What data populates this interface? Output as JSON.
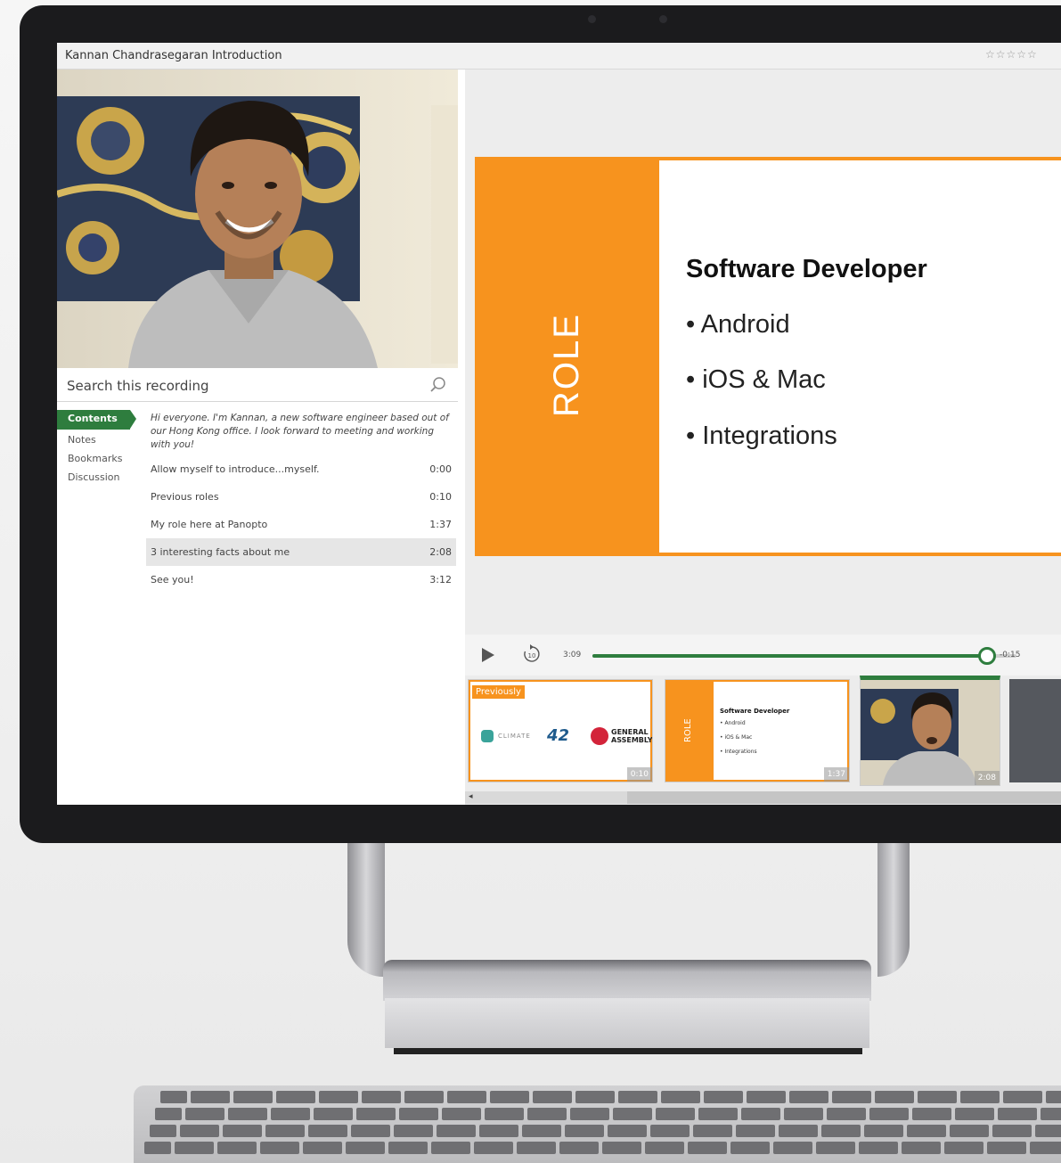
{
  "window": {
    "title": "Kannan Chandrasegaran Introduction",
    "rating": "☆☆☆☆☆"
  },
  "search": {
    "placeholder": "Search this recording"
  },
  "nav": {
    "items": [
      {
        "label": "Contents",
        "active": true
      },
      {
        "label": "Notes",
        "active": false
      },
      {
        "label": "Bookmarks",
        "active": false
      },
      {
        "label": "Discussion",
        "active": false
      }
    ]
  },
  "transcript": {
    "caption": "Hi everyone. I'm Kannan, a new software engineer based out of our Hong Kong office. I look forward to meeting and working with you!",
    "entries": [
      {
        "title": "Allow myself to introduce...myself.",
        "time": "0:00"
      },
      {
        "title": "Previous roles",
        "time": "0:10"
      },
      {
        "title": "My role here at Panopto",
        "time": "1:37"
      },
      {
        "title": "3 interesting facts about me",
        "time": "2:08"
      },
      {
        "title": "See you!",
        "time": "3:12"
      }
    ]
  },
  "slide": {
    "band_label": "ROLE",
    "title": "Software Developer",
    "bullets": [
      "• Android",
      "• iOS & Mac",
      "• Integrations"
    ]
  },
  "player": {
    "elapsed": "3:09",
    "remaining": "-0:15",
    "progress": 0.93
  },
  "thumbnails": [
    {
      "label": "Previously",
      "logos": [
        "CLIMATE",
        "GENERAL ASSEMBLY"
      ],
      "time": "0:10"
    },
    {
      "band_label": "ROLE",
      "title": "Software Developer",
      "bullets": [
        "• Android",
        "• iOS & Mac",
        "• Integrations"
      ],
      "time": "1:37"
    },
    {
      "time": "2:08"
    }
  ],
  "colors": {
    "accent_green": "#2e7d3e",
    "slide_orange": "#f7931e"
  }
}
